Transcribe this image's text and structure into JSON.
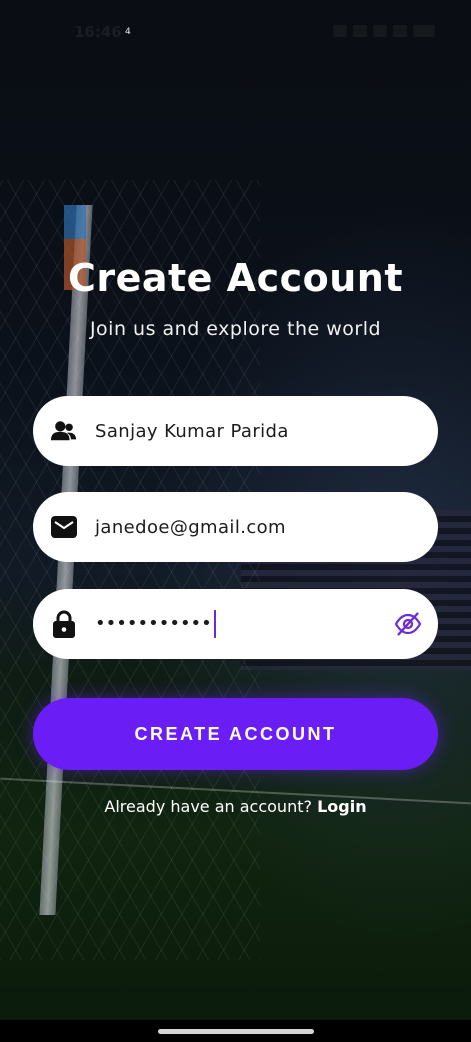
{
  "status_bar": {
    "time": "16:46",
    "time_superscript": "4"
  },
  "header": {
    "title": "Create Account",
    "subtitle": "Join us and explore the world"
  },
  "form": {
    "name_value": "Sanjay Kumar Parida",
    "email_value": "janedoe@gmail.com",
    "password_masked": "•••••••••••"
  },
  "actions": {
    "create_account_label": "CREATE ACCOUNT",
    "already_text": "Already have an account?",
    "login_label": "Login"
  },
  "colors": {
    "accent": "#6a1df5",
    "eye_icon": "#6c2bd9"
  },
  "icons": {
    "name": "users-icon",
    "email": "envelope-icon",
    "password": "lock-icon",
    "toggle": "eye-slash-icon"
  }
}
